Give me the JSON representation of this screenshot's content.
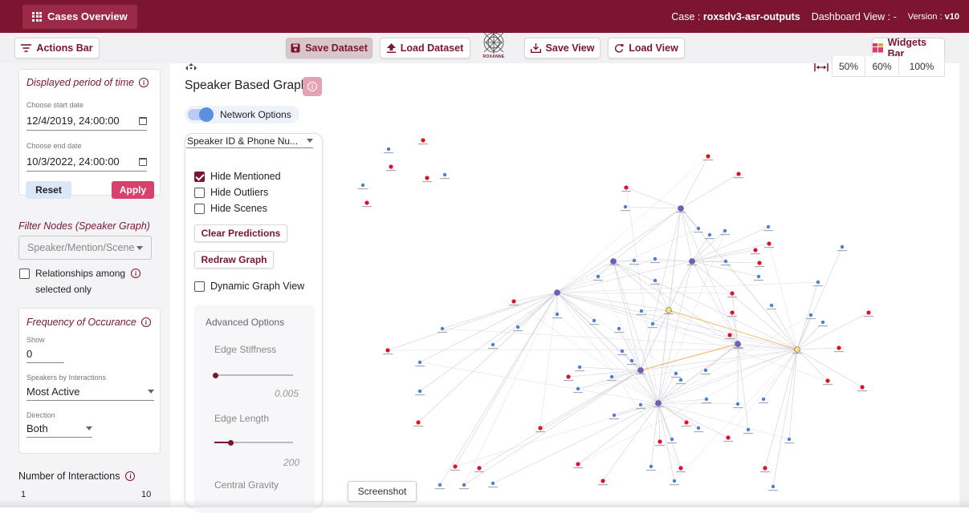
{
  "topbar": {
    "cases_label": "Cases Overview",
    "case_prefix": "Case : ",
    "case_name": "roxsdv3-asr-outputs",
    "dashboard_view": "Dashboard View : -",
    "version_prefix": "Version : ",
    "version": "v10"
  },
  "toolbar": {
    "actions_bar": "Actions Bar",
    "save_dataset": "Save Dataset",
    "load_dataset": "Load Dataset",
    "logo_text": "ROXANNE",
    "save_view": "Save View",
    "load_view": "Load View",
    "widgets_bar": "Widgets Bar"
  },
  "period": {
    "title": "Displayed period of time",
    "start_label": "Choose start date",
    "start_value": "12/4/2019, 24:00:00",
    "end_label": "Choose end date",
    "end_value": "10/3/2022, 24:00:00",
    "reset": "Reset",
    "apply": "Apply"
  },
  "filter_nodes": {
    "title": "Filter Nodes (Speaker Graph)",
    "placeholder": "Speaker/Mention/Scene",
    "relationships_line1": "Relationships among",
    "relationships_line2": "selected only"
  },
  "frequency": {
    "title": "Frequency of Occurance",
    "show_label": "Show",
    "show_value": "0",
    "speakers_label": "Speakers by Interactions",
    "speakers_value": "Most Active",
    "direction_label": "Direction",
    "direction_value": "Both"
  },
  "interactions": {
    "title": "Number of Interactions",
    "min": "1",
    "max": "10"
  },
  "graph": {
    "title": "Speaker Based Graph",
    "network_options": "Network Options",
    "select_value": "Speaker ID & Phone Nu...",
    "hide_mentioned": "Hide Mentioned",
    "hide_outliers": "Hide Outliers",
    "hide_scenes": "Hide Scenes",
    "clear_predictions": "Clear Predictions",
    "redraw_graph": "Redraw Graph",
    "dynamic_view": "Dynamic Graph View",
    "advanced_options": "Advanced Options",
    "edge_stiffness": "Edge Stiffness",
    "edge_stiffness_value": "0.005",
    "edge_length": "Edge Length",
    "edge_length_value": "200",
    "central_gravity": "Central Gravity",
    "screenshot": "Screenshot"
  },
  "zoom": {
    "z50": "50%",
    "z60": "60%",
    "z100": "100%"
  },
  "colors": {
    "brand": "#7c1530",
    "apply": "#d9416d",
    "node_red": "#e0102a",
    "node_blue": "#4a7fd4"
  }
}
